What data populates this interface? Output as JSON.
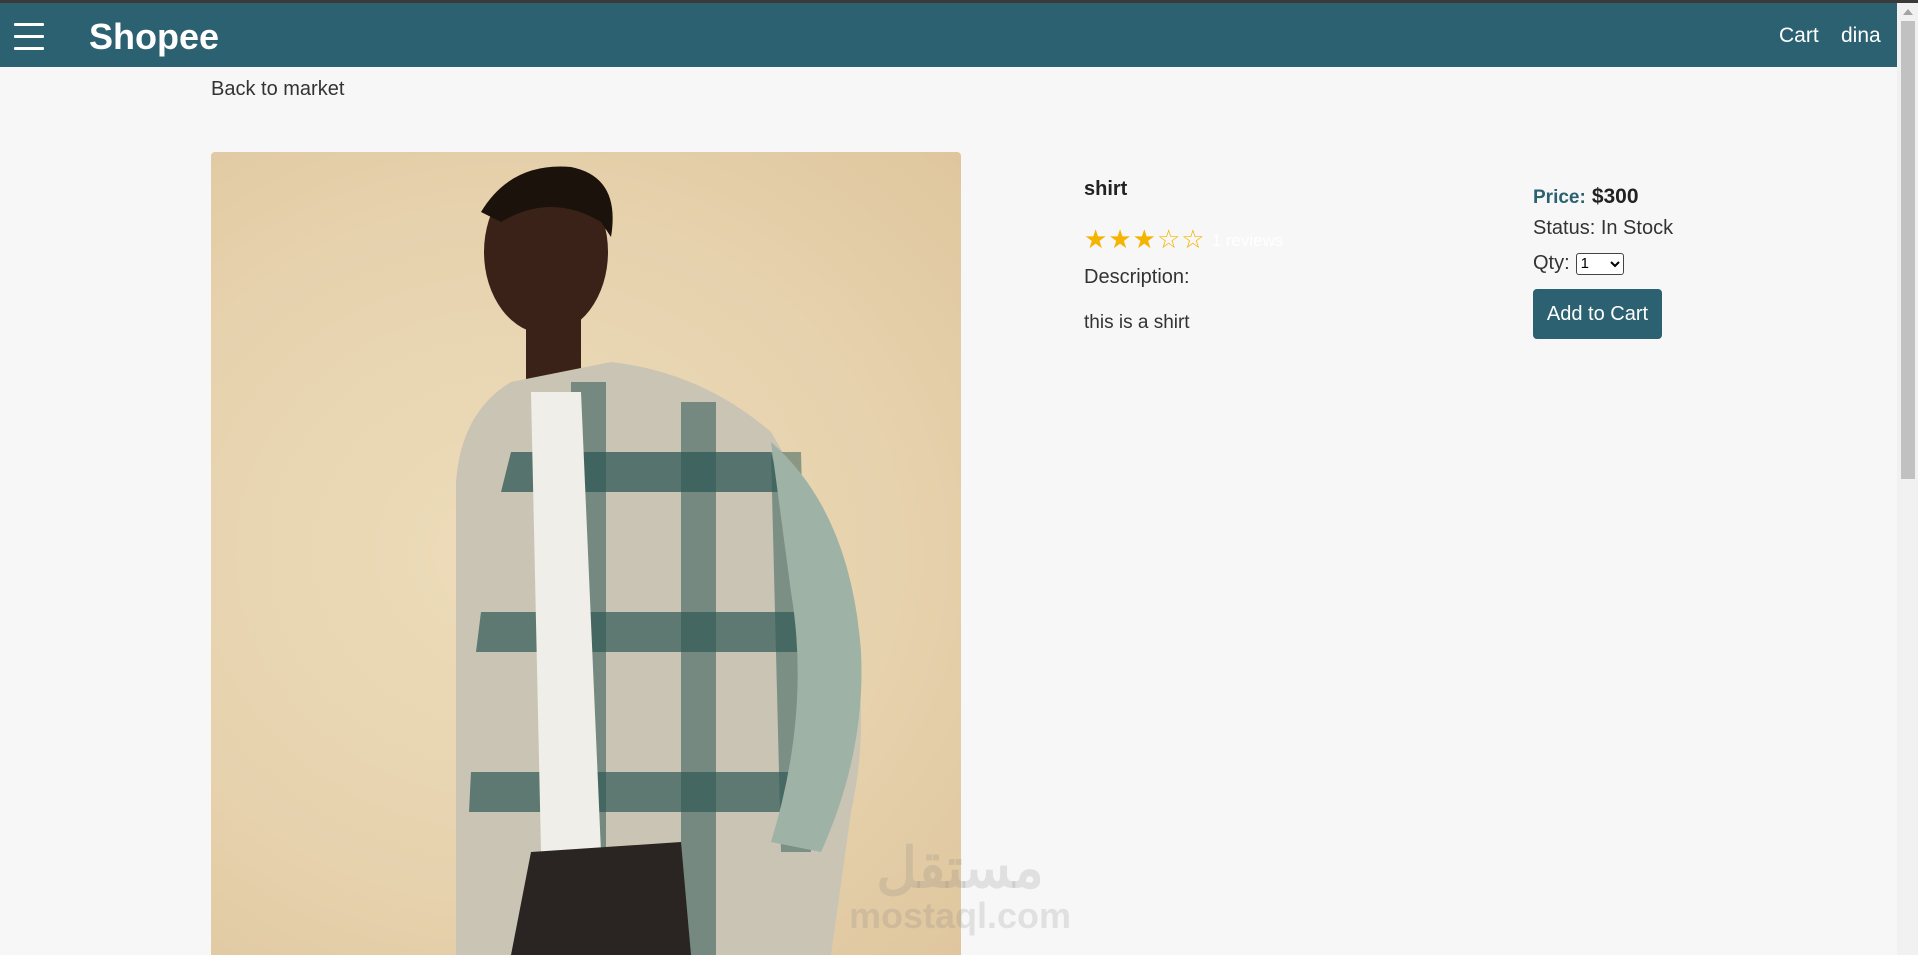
{
  "header": {
    "brand": "Shopee",
    "nav": {
      "cart": "Cart",
      "user": "dina"
    }
  },
  "back_link": "Back to market",
  "product": {
    "name": "shirt",
    "rating": {
      "value": 3,
      "max": 5,
      "reviews_text": "1 reviews"
    },
    "description_label": "Description:",
    "description": "this is a shirt",
    "price_label": "Price:",
    "price": "$300",
    "status": "Status: In Stock",
    "qty_label": "Qty:",
    "qty_selected": "1",
    "add_to_cart": "Add to Cart"
  },
  "watermark": {
    "arabic": "مستقل",
    "latin": "mostaql.com"
  },
  "colors": {
    "header": "#2b6170",
    "accent": "#2b6170",
    "star": "#f4b400",
    "background": "#f7f7f7"
  },
  "icons": {
    "menu": "hamburger-menu-icon",
    "star_filled": "star-filled-icon",
    "star_empty": "star-empty-icon"
  }
}
